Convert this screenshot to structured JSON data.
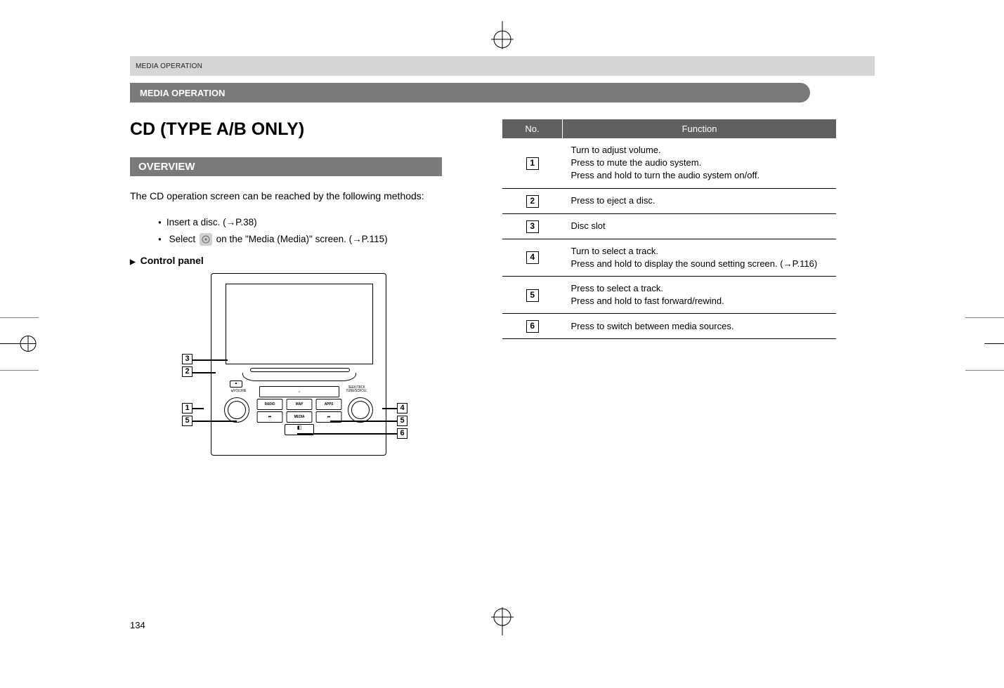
{
  "running_header": "MEDIA OPERATION",
  "section_heading": "MEDIA OPERATION",
  "page_title": "CD (TYPE A/B ONLY)",
  "subhead": "OVERVIEW",
  "intro": "The CD operation screen can be reached by the following methods:",
  "bullets": {
    "b0": "Insert a disc. (→P.38)",
    "b1_pre": "Select",
    "b1_post": "on the \"Media (Media)\" screen. (→P.115)"
  },
  "control_panel_label": "Control panel",
  "panel_labels": {
    "volume": "ᴓ/VOLUME",
    "tune_top": "SEEK/TRCK",
    "tune_bottom": "TUNE/SCROLL",
    "row1_home": "⌂",
    "row2_radio": "RADIO",
    "row2_map": "MAP",
    "row2_apps": "APPS",
    "row3_prev": "⏮",
    "row3_media": "MEDIA",
    "row3_next": "⏭",
    "mic": "◧"
  },
  "callout_nums": {
    "n1": "1",
    "n2": "2",
    "n3": "3",
    "n4": "4",
    "n5": "5",
    "n6": "6"
  },
  "table_headers": {
    "no": "No.",
    "function": "Function"
  },
  "table_rows": {
    "r1": "Turn to adjust volume.\nPress to mute the audio system.\nPress and hold to turn the audio system on/off.",
    "r2": "Press to eject a disc.",
    "r3": "Disc slot",
    "r4": "Turn to select a track.\nPress and hold to display the sound setting screen. (→P.116)",
    "r5": "Press to select a track.\nPress and hold to fast forward/rewind.",
    "r6": "Press to switch between media sources."
  },
  "page_number": "134"
}
